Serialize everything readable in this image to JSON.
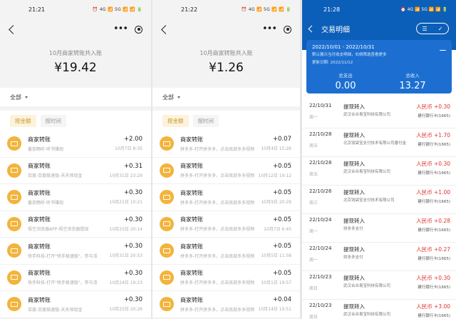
{
  "panels": [
    {
      "status": {
        "time": "21:21",
        "icons": "⏰ 4G 📶 5G 📶 📶 🔋"
      },
      "summary_label": "10月商家转账共入账",
      "summary_value": "¥19.42",
      "filter": "全部",
      "tabs": [
        "按金额",
        "按时间"
      ],
      "items": [
        {
          "title": "商家转账",
          "sub": "番茄畅听-听书赚现",
          "amount": "+2.00",
          "time": "10月7日 8:35"
        },
        {
          "title": "商家转账",
          "sub": "百度-百度极速版-天天领现金",
          "amount": "+0.31",
          "time": "10月31日 23:29"
        },
        {
          "title": "商家转账",
          "sub": "番茄畅听-听书赚现",
          "amount": "+0.30",
          "time": "10月21日 10:21"
        },
        {
          "title": "商家转账",
          "sub": "悟空浏览器APP-悟空浏览器提现",
          "amount": "+0.30",
          "time": "10月25日 20:14"
        },
        {
          "title": "商家转账",
          "sub": "快手科技-打开\"快手极速版\"，参与活",
          "amount": "+0.30",
          "time": "10月31日 20:53"
        },
        {
          "title": "商家转账",
          "sub": "快手科技-打开\"快手极速版\"，参与活",
          "amount": "+0.30",
          "time": "10月24日 19:23"
        },
        {
          "title": "商家转账",
          "sub": "百度-百度极速版-天天领现金",
          "amount": "+0.30",
          "time": "10月25日 20:26"
        }
      ]
    },
    {
      "status": {
        "time": "21:22",
        "icons": "⏰ 4G 📶 5G 📶 📶 🔋"
      },
      "summary_label": "10月商家转账共入账",
      "summary_value": "¥1.26",
      "filter": "全部",
      "tabs": [
        "按金额",
        "按时间"
      ],
      "items": [
        {
          "title": "商家转账",
          "sub": "拼多多-打开拼多多，点击底部多多视频",
          "amount": "+0.07",
          "time": "10月4日 15:26"
        },
        {
          "title": "商家转账",
          "sub": "拼多多-打开拼多多，点击底部多多视频",
          "amount": "+0.05",
          "time": "10月12日 19:12"
        },
        {
          "title": "商家转账",
          "sub": "拼多多-打开拼多多，点击底部多多视频",
          "amount": "+0.05",
          "time": "10月9日 20:29"
        },
        {
          "title": "商家转账",
          "sub": "拼多多-打开拼多多，点击底部多多视频",
          "amount": "+0.05",
          "time": "10月7日 6:45"
        },
        {
          "title": "商家转账",
          "sub": "拼多多-打开拼多多，点击底部多多视频",
          "amount": "+0.05",
          "time": "10月5日 11:58"
        },
        {
          "title": "商家转账",
          "sub": "拼多多-打开拼多多，点击底部多多视频",
          "amount": "+0.05",
          "time": "10月1日 19:57"
        },
        {
          "title": "商家转账",
          "sub": "拼多多-打开拼多多，点击底部多多视频",
          "amount": "+0.04",
          "time": "10月14日 19:51"
        }
      ]
    },
    {
      "status": {
        "time": "21:28",
        "icons": "⏰ 4G 📶 5G 📶 📶 🔋"
      },
      "title": "交易明细",
      "date_range": "2022/10/01 - 2022/10/31",
      "note": "默认展示当月收支明细，右侧筛选查看更多",
      "update": "更新日期: 2022/11/12",
      "expense_label": "总支出",
      "expense": "0.00",
      "income_label": "总收入",
      "income": "13.27",
      "rows": [
        {
          "date": "22/10/31",
          "week": "周一",
          "type": "提现转入",
          "party": "武汉合众易宝科技有限公司",
          "amount": "人民币 +0.30",
          "bank": "建行银行卡(1665)"
        },
        {
          "date": "22/10/28",
          "week": "周五",
          "type": "提现转入",
          "party": "北京钱袋宝支付技术有限公司番付金",
          "amount": "人民币 +1.70",
          "bank": "建行银行卡(1665)"
        },
        {
          "date": "22/10/28",
          "week": "周五",
          "type": "提现转入",
          "party": "武汉合众易宝科技有限公司",
          "amount": "人民币 +0.30",
          "bank": "建行银行卡(1665)"
        },
        {
          "date": "22/10/26",
          "week": "周三",
          "type": "提现转入",
          "party": "北京钱袋宝支付技术有限公司",
          "amount": "人民币 +1.00",
          "bank": "建行银行卡(1665)"
        },
        {
          "date": "22/10/24",
          "week": "周一",
          "type": "提现转入",
          "party": "拼多多支付",
          "amount": "人民币 +0.28",
          "bank": "建行银行卡(1665)"
        },
        {
          "date": "22/10/24",
          "week": "周一",
          "type": "提现转入",
          "party": "拼多多支付",
          "amount": "人民币 +0.27",
          "bank": "建行银行卡(1665)"
        },
        {
          "date": "22/10/23",
          "week": "周日",
          "type": "提现转入",
          "party": "武汉合众易宝科技有限公司",
          "amount": "人民币 +0.30",
          "bank": "建行银行卡(1665)"
        },
        {
          "date": "22/10/23",
          "week": "周日",
          "type": "提现转入",
          "party": "武汉合众易宝科技有限公司",
          "amount": "人民币 +3.00",
          "bank": "建行银行卡(1665)"
        }
      ]
    }
  ]
}
